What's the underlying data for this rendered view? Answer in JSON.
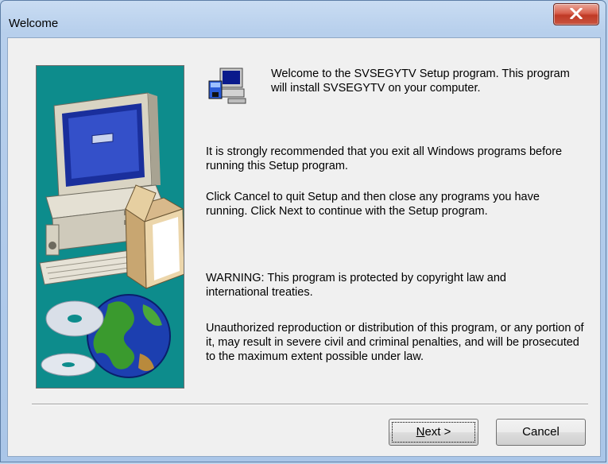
{
  "window": {
    "title": "Welcome",
    "close_icon": "close-icon"
  },
  "content": {
    "intro": "Welcome to the SVSEGYTV Setup program.  This program will install SVSEGYTV on your computer.",
    "recommend": "It is strongly recommended that you exit all Windows programs before running this Setup program.",
    "instructions": "Click Cancel to quit Setup and then close any programs you have running.  Click Next to continue with the Setup program.",
    "warning": "WARNING: This program is protected by copyright law and international treaties.",
    "legal": "Unauthorized reproduction or distribution of this program, or any portion of it, may result in severe civil and criminal penalties, and will be prosecuted to the maximum extent possible under law."
  },
  "buttons": {
    "next_mnemonic": "N",
    "next_rest": "ext >",
    "cancel": "Cancel"
  },
  "colors": {
    "banner_background": "#0d8c8c",
    "close_button": "#c8533f"
  }
}
